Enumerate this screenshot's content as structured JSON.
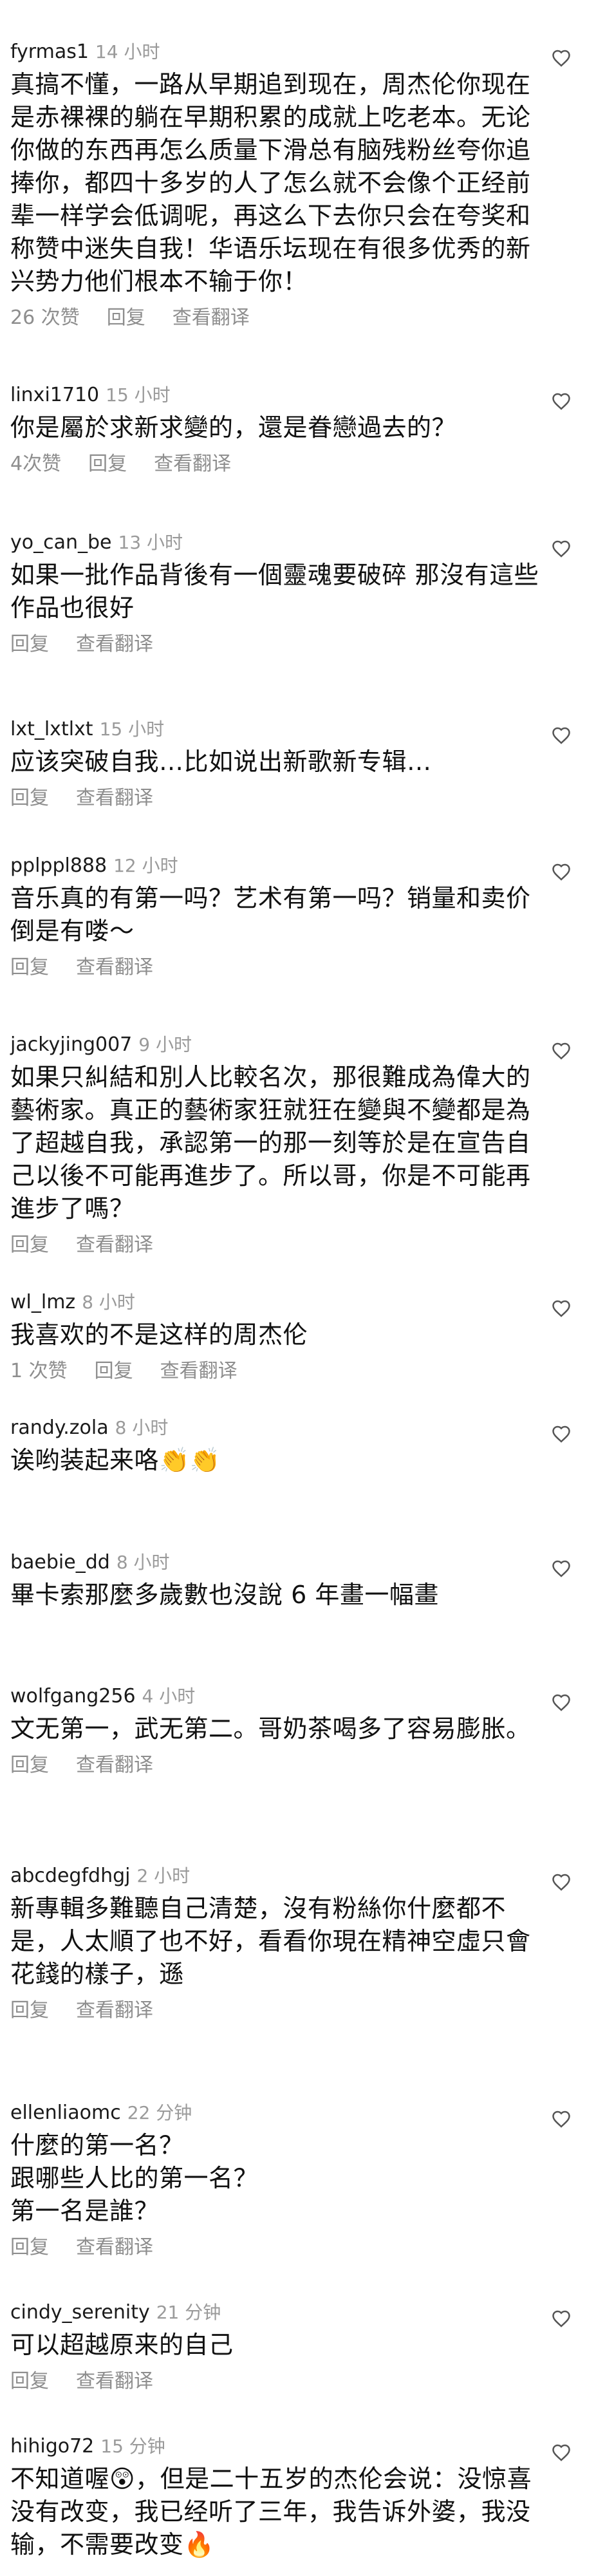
{
  "comments": [
    {
      "username": "fyrmas1",
      "time": "14 小时",
      "text": "真搞不懂，一路从早期追到现在，周杰伦你现在是赤裸裸的躺在早期积累的成就上吃老本。无论你做的东西再怎么质量下滑总有脑残粉丝夸你追捧你，都四十多岁的人了怎么就不会像个正经前辈一样学会低调呢，再这么下去你只会在夸奖和称赞中迷失自我！华语乐坛现在有很多优秀的新兴势力他们根本不输于你！",
      "likes": "26 次赞",
      "reply_label": "回复",
      "translate_label": "查看翻译"
    },
    {
      "username": "linxi1710",
      "time": "15 小时",
      "text": "你是屬於求新求變的，還是眷戀過去的？",
      "likes": "4次赞",
      "reply_label": "回复",
      "translate_label": "查看翻译"
    },
    {
      "username": "yo_can_be",
      "time": "13 小时",
      "text": "如果一批作品背後有一個靈魂要破碎 那沒有這些作品也很好",
      "likes": "",
      "reply_label": "回复",
      "translate_label": "查看翻译"
    },
    {
      "username": "lxt_lxtlxt",
      "time": "15 小时",
      "text": "应该突破自我…比如说出新歌新专辑…",
      "likes": "",
      "reply_label": "回复",
      "translate_label": "查看翻译"
    },
    {
      "username": "pplppl888",
      "time": "12 小时",
      "text": "音乐真的有第一吗？艺术有第一吗？销量和卖价倒是有喽～",
      "likes": "",
      "reply_label": "回复",
      "translate_label": "查看翻译"
    },
    {
      "username": "jackyjing007",
      "time": "9 小时",
      "text": "如果只糾結和別人比較名次，那很難成為偉大的藝術家。真正的藝術家狂就狂在變與不變都是為了超越自我，承認第一的那一刻等於是在宣告自己以後不可能再進步了。所以哥，你是不可能再進步了嗎？",
      "likes": "",
      "reply_label": "回复",
      "translate_label": "查看翻译"
    },
    {
      "username": "wl_lmz",
      "time": "8 小时",
      "text": "我喜欢的不是这样的周杰伦",
      "likes": "1 次赞",
      "reply_label": "回复",
      "translate_label": "查看翻译"
    },
    {
      "username": "randy.zola",
      "time": "8 小时",
      "text": "诶哟装起来咯👏👏",
      "likes": "",
      "reply_label": "",
      "translate_label": ""
    },
    {
      "username": "baebie_dd",
      "time": "8 小时",
      "text": "畢卡索那麼多歲數也沒說 6 年畫一幅畫",
      "likes": "",
      "reply_label": "",
      "translate_label": ""
    },
    {
      "username": "wolfgang256",
      "time": "4 小时",
      "text": "文无第一，武无第二。哥奶茶喝多了容易膨胀。",
      "likes": "",
      "reply_label": "回复",
      "translate_label": "查看翻译"
    },
    {
      "username": "abcdegfdhgj",
      "time": "2 小时",
      "text": "新專輯多難聽自己清楚，沒有粉絲你什麼都不是，人太順了也不好，看看你現在精神空虛只會花錢的樣子，遜",
      "likes": "",
      "reply_label": "回复",
      "translate_label": "查看翻译"
    },
    {
      "username": "ellenliaomc",
      "time": "22 分钟",
      "text": "什麼的第一名？\n跟哪些人比的第一名？\n第一名是誰？",
      "likes": "",
      "reply_label": "回复",
      "translate_label": "查看翻译"
    },
    {
      "username": "cindy_serenity",
      "time": "21 分钟",
      "text": "可以超越原来的自己",
      "likes": "",
      "reply_label": "回复",
      "translate_label": "查看翻译"
    },
    {
      "username": "hihigo72",
      "time": "15 分钟",
      "text": "不知道喔😲，但是二十五岁的杰伦会说：没惊喜没有改变，我已经听了三年，我告诉外婆，我没输，不需要改变🔥",
      "likes": "",
      "reply_label": "",
      "translate_label": ""
    }
  ],
  "colors": {
    "text": "#111111",
    "meta": "#9a9a9a",
    "actions": "#8e8e8e",
    "heart_stroke": "#555555"
  },
  "icons": {
    "like": "heart-outline-icon"
  }
}
